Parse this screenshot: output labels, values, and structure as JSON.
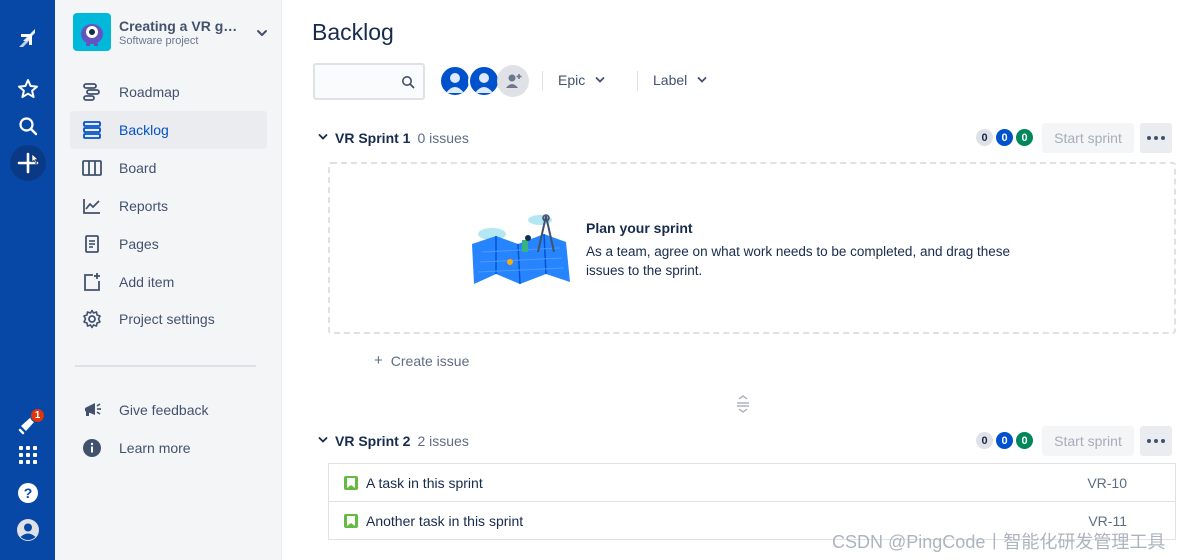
{
  "global_nav": {
    "icons": [
      "jira-logo-icon",
      "star-icon",
      "search-icon",
      "create-icon",
      "notifications-icon",
      "app-switcher-icon",
      "help-icon",
      "profile-icon"
    ],
    "notification_count": "1"
  },
  "project": {
    "name": "Creating a VR game",
    "type": "Software project",
    "accent": "#00b8d9"
  },
  "sidebar": {
    "items": [
      {
        "label": "Roadmap",
        "icon": "roadmap-icon"
      },
      {
        "label": "Backlog",
        "icon": "backlog-icon",
        "selected": true
      },
      {
        "label": "Board",
        "icon": "board-icon"
      },
      {
        "label": "Reports",
        "icon": "reports-icon"
      },
      {
        "label": "Pages",
        "icon": "pages-icon"
      },
      {
        "label": "Add item",
        "icon": "add-item-icon"
      },
      {
        "label": "Project settings",
        "icon": "settings-icon"
      }
    ],
    "footer": [
      {
        "label": "Give feedback",
        "icon": "megaphone-icon"
      },
      {
        "label": "Learn more",
        "icon": "info-icon"
      }
    ]
  },
  "main": {
    "title": "Backlog",
    "search_placeholder": "",
    "filters": [
      "Epic",
      "Label"
    ],
    "sprints": [
      {
        "name": "VR Sprint 1",
        "count_label": "0 issues",
        "status_counts": [
          "0",
          "0",
          "0"
        ],
        "start_label": "Start sprint",
        "issues": []
      },
      {
        "name": "VR Sprint 2",
        "count_label": "2 issues",
        "status_counts": [
          "0",
          "0",
          "0"
        ],
        "start_label": "Start sprint",
        "issues": [
          {
            "summary": "A task in this sprint",
            "key": "VR-10"
          },
          {
            "summary": "Another task in this sprint",
            "key": "VR-11"
          }
        ]
      }
    ],
    "empty_state": {
      "title": "Plan your sprint",
      "description": "As a team, agree on what work needs to be completed, and drag these issues to the sprint."
    },
    "create_issue_label": "Create issue"
  },
  "colors": {
    "nav_bg": "#0747a6",
    "selected": "#0052cc",
    "done": "#00875a",
    "task": "#65ba43"
  },
  "watermark": "CSDN @PingCode丨智能化研发管理工具"
}
